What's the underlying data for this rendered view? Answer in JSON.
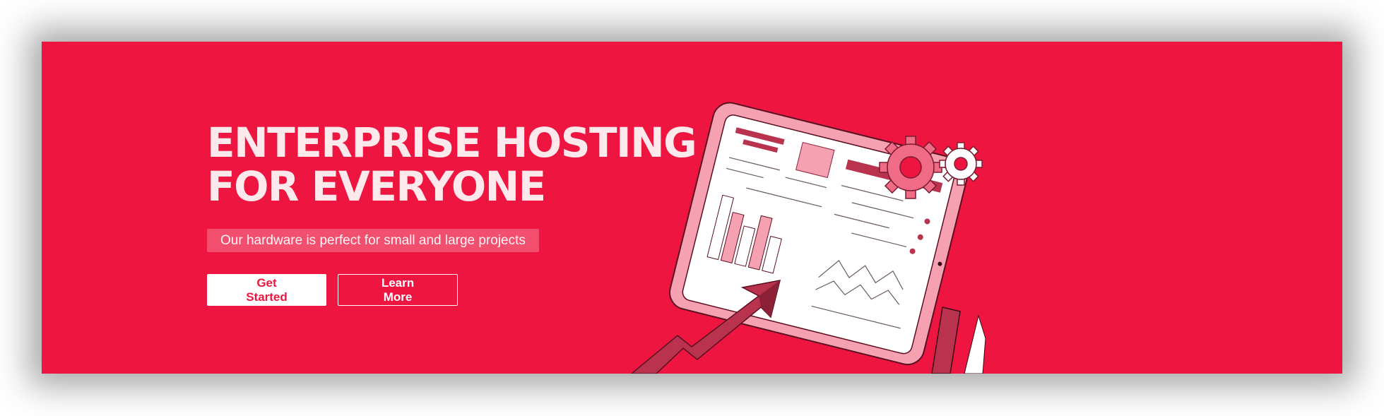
{
  "hero": {
    "headline_line1": "ENTERPRISE HOSTING",
    "headline_line2": "FOR EVERYONE",
    "subtitle": "Our hardware is perfect for small and large projects",
    "primary_button": "Get Started",
    "secondary_button": "Learn More"
  },
  "colors": {
    "banner_bg": "#ee1641",
    "headline": "#fde8ec",
    "chip_bg": "#f24e6e",
    "dark_accent": "#b9334f",
    "light_accent": "#f6a1b2"
  },
  "illustration": {
    "icons": [
      "tablet-illustration",
      "gear-icon",
      "gear-icon",
      "trend-arrow-icon",
      "bar-chart-icon"
    ]
  }
}
